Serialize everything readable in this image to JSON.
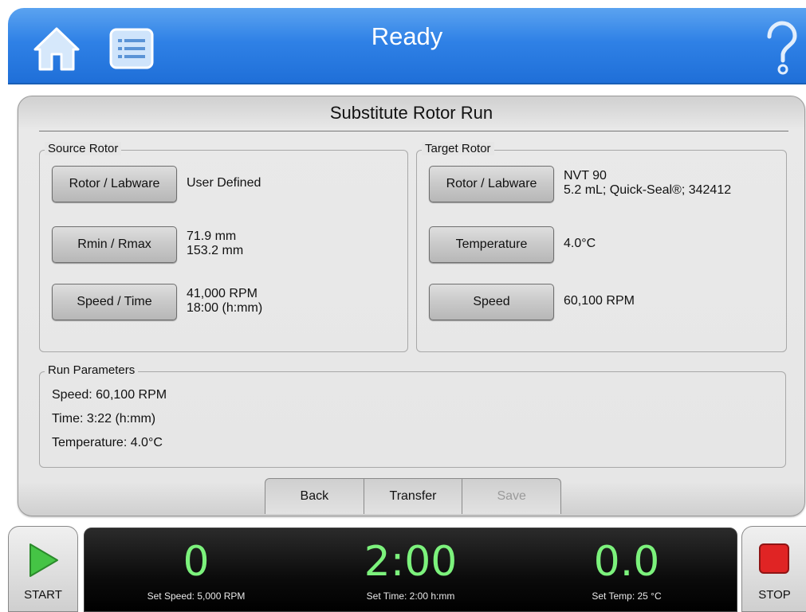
{
  "header": {
    "title": "Ready"
  },
  "page_title": "Substitute Rotor Run",
  "source_rotor": {
    "label": "Source Rotor",
    "rows": [
      {
        "button": "Rotor / Labware",
        "value": [
          "User Defined"
        ]
      },
      {
        "button": "Rmin / Rmax",
        "value": [
          "71.9 mm",
          "153.2 mm"
        ]
      },
      {
        "button": "Speed / Time",
        "value": [
          "41,000 RPM",
          "18:00 (h:mm)"
        ]
      }
    ]
  },
  "target_rotor": {
    "label": "Target Rotor",
    "rows": [
      {
        "button": "Rotor / Labware",
        "value": [
          "NVT 90",
          "5.2 mL; Quick-Seal®; 342412"
        ]
      },
      {
        "button": "Temperature",
        "value": [
          "4.0°C"
        ]
      },
      {
        "button": "Speed",
        "value": [
          "60,100 RPM"
        ]
      }
    ]
  },
  "run_parameters": {
    "label": "Run Parameters",
    "lines": [
      "Speed: 60,100 RPM",
      "Time: 3:22 (h:mm)",
      "Temperature: 4.0°C"
    ]
  },
  "tabs": [
    {
      "label": "Back",
      "enabled": true
    },
    {
      "label": "Transfer",
      "enabled": true
    },
    {
      "label": "Save",
      "enabled": false
    }
  ],
  "status_bar": {
    "start_label": "START",
    "stop_label": "STOP",
    "speed": {
      "value": "0",
      "set_label": "Set Speed: 5,000 RPM"
    },
    "time": {
      "value": "2:00",
      "set_label": "Set Time: 2:00 h:mm"
    },
    "temp": {
      "value": "0.0",
      "set_label": "Set Temp: 25 °C"
    }
  },
  "colors": {
    "header_blue": "#2f81e6",
    "readout_green": "#7cf27c",
    "stop_red": "#d81e1e",
    "start_green": "#3dbb3d"
  },
  "icons": [
    "home-icon",
    "list-menu-icon",
    "help-icon",
    "play-icon",
    "stop-square-icon"
  ]
}
